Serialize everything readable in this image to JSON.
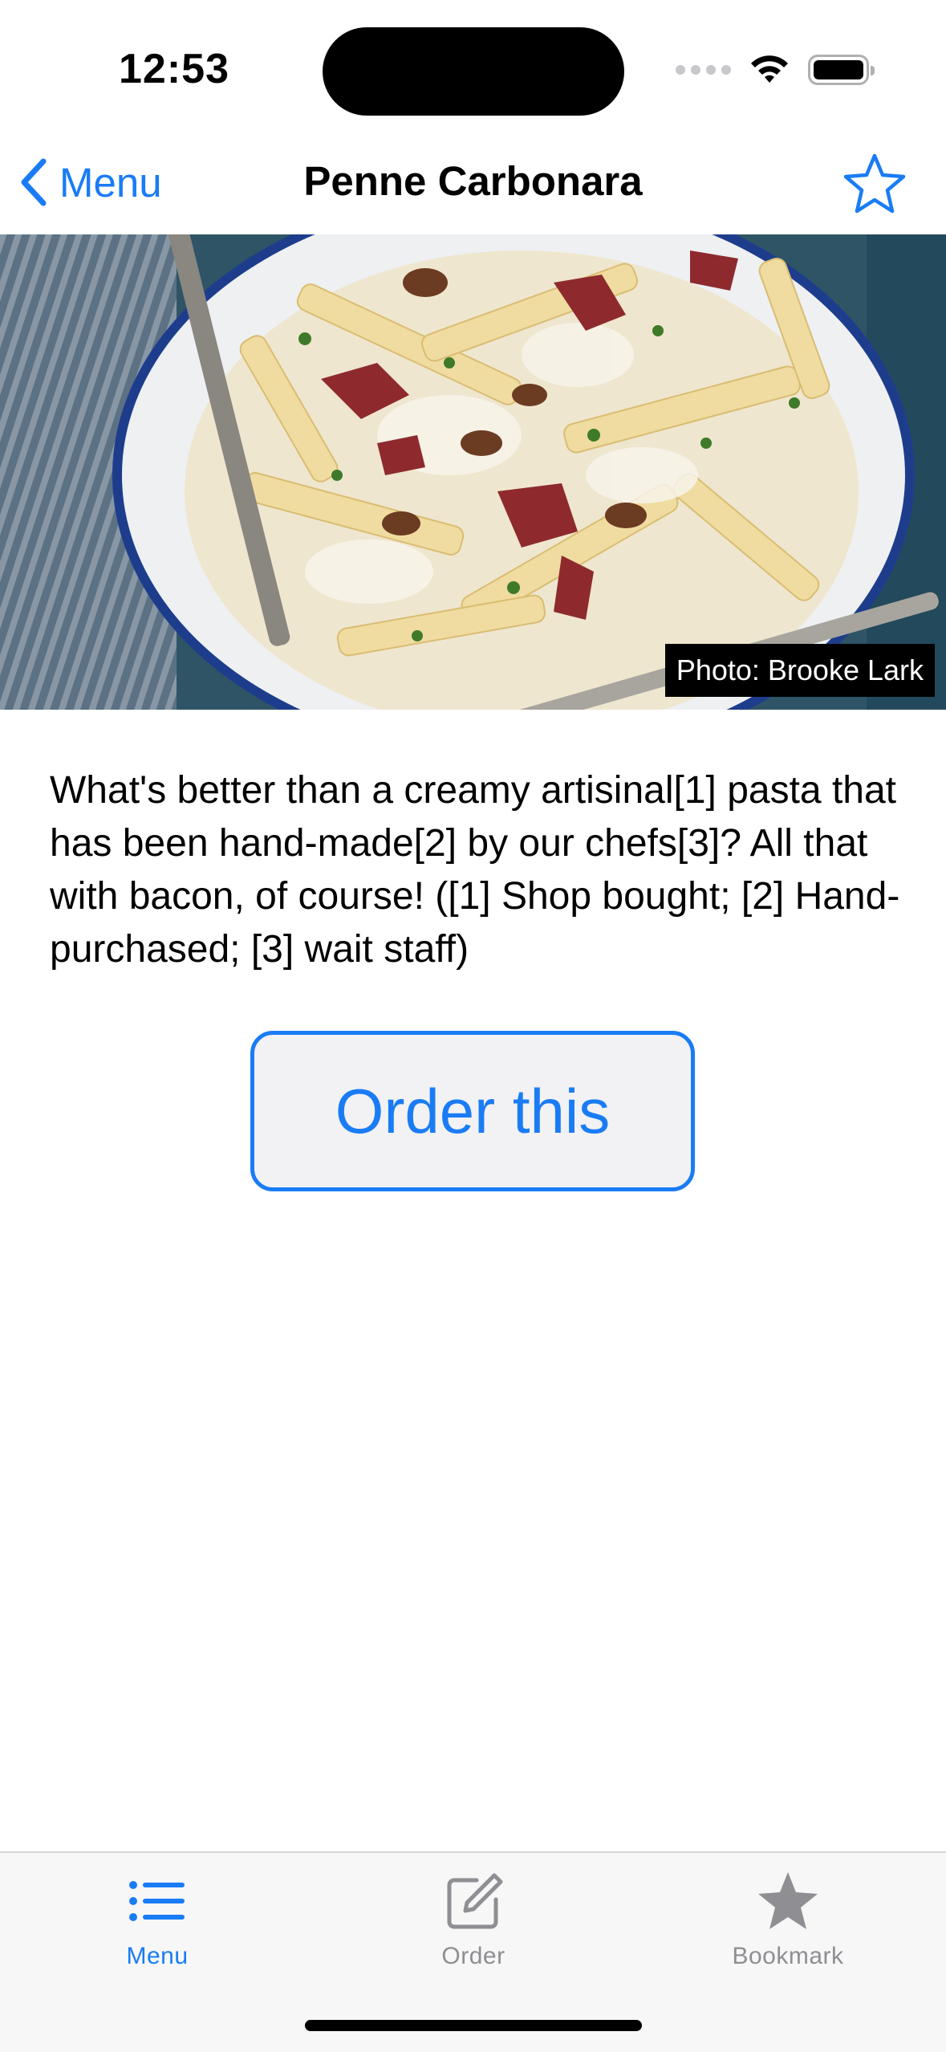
{
  "status_bar": {
    "time": "12:53"
  },
  "nav": {
    "back_label": "Menu",
    "title": "Penne Carbonara"
  },
  "hero": {
    "photo_credit": "Photo: Brooke Lark"
  },
  "description": "What's better than a creamy artisinal[1] pasta that has been hand-made[2] by our chefs[3]? All that with bacon, of course! ([1] Shop bought; [2] Hand-purchased; [3] wait staff)",
  "order_button": {
    "label": "Order this"
  },
  "tabbar": {
    "items": [
      {
        "label": "Menu",
        "icon": "list-icon",
        "active": true
      },
      {
        "label": "Order",
        "icon": "compose-icon",
        "active": false
      },
      {
        "label": "Bookmark",
        "icon": "star-filled-icon",
        "active": false
      }
    ]
  },
  "colors": {
    "accent": "#1a7cf5",
    "inactive": "#8e8e93",
    "tabbar_bg": "#f7f7f7"
  }
}
